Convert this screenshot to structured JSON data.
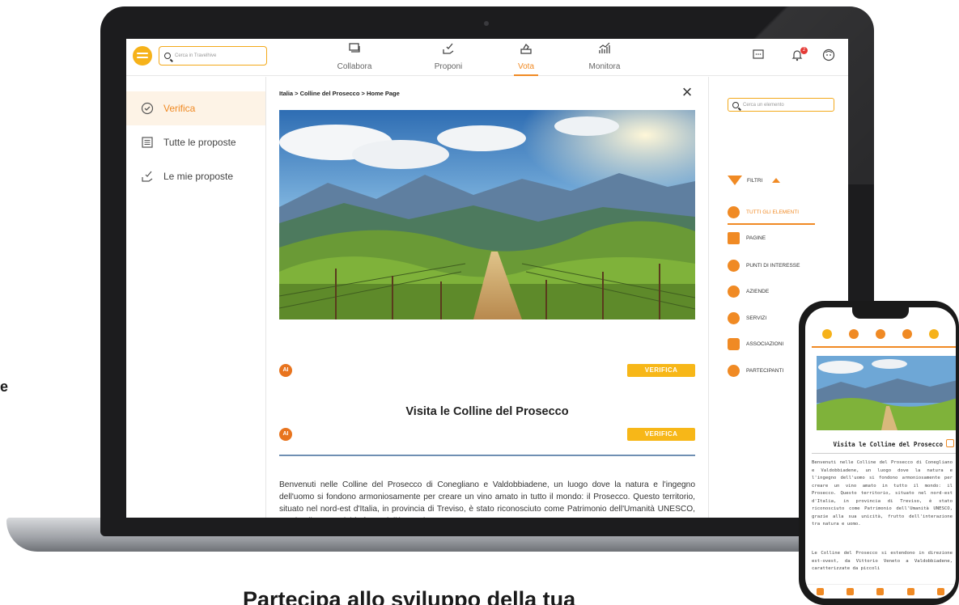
{
  "app": {
    "search_placeholder": "Cerca in Travelhive",
    "nav_tabs": [
      {
        "label": "Collabora",
        "icon": "chat-box-icon"
      },
      {
        "label": "Proponi",
        "icon": "hand-proposal-icon"
      },
      {
        "label": "Vota",
        "icon": "ballot-box-icon",
        "active": true
      },
      {
        "label": "Monitora",
        "icon": "chart-icon"
      }
    ],
    "notification_count": "2",
    "accent_color": "#f08a24",
    "button_color": "#f7b718"
  },
  "sidebar": {
    "items": [
      {
        "label": "Verifica",
        "icon": "check-circle-icon",
        "active": true
      },
      {
        "label": "Tutte le proposte",
        "icon": "list-icon"
      },
      {
        "label": "Le mie proposte",
        "icon": "hand-proposal-icon"
      }
    ]
  },
  "main": {
    "breadcrumb": "Italia > Colline del Prosecco > Home Page",
    "ai_label": "AI",
    "verify_label": "VERIFICA",
    "title": "Visita le Colline del Prosecco",
    "body": "Benvenuti nelle Colline del Prosecco di Conegliano e Valdobbiadene, un luogo dove la natura e l'ingegno dell'uomo si fondono armoniosamente per creare un vino amato in tutto il mondo: il Prosecco. Questo territorio, situato nel nord-est d'Italia, in provincia di Treviso, è stato riconosciuto come Patrimonio dell'Umanità UNESCO, grazie alla sua unicità, frutto dell'interazione"
  },
  "right_panel": {
    "search_placeholder": "Cerca un elemento",
    "filters_label": "FILTRI",
    "categories": [
      {
        "label": "TUTTI GLI ELEMENTI",
        "active": true
      },
      {
        "label": "PAGINE"
      },
      {
        "label": "PUNTI DI INTERESSE"
      },
      {
        "label": "AZIENDE"
      },
      {
        "label": "SERVIZI"
      },
      {
        "label": "ASSOCIAZIONI"
      },
      {
        "label": "PARTECIPANTI"
      }
    ]
  },
  "phone": {
    "title": "Visita le Colline del Prosecco",
    "paragraph1": "Benvenuti nelle Colline del Prosecco di Conegliano e Valdobbiadene, un luogo dove la natura e l'ingegno dell'uomo si fondono armoniosamente per creare un vino amato in tutto il mondo: il Prosecco. Questo territorio, situato nel nord-est d'Italia, in provincia di Treviso, è stato riconosciuto come Patrimonio dell'Umanità UNESCO, grazie alla sua unicità, frutto dell'interazione tra natura e uomo.",
    "paragraph2": "Le Colline del Prosecco si estendono in direzione est-ovest, da Vittorio Veneto a Valdobbiadene, caratterizzate da piccoli"
  },
  "page": {
    "headline": "Partecipa allo sviluppo della tua",
    "edge_letter": "e"
  }
}
